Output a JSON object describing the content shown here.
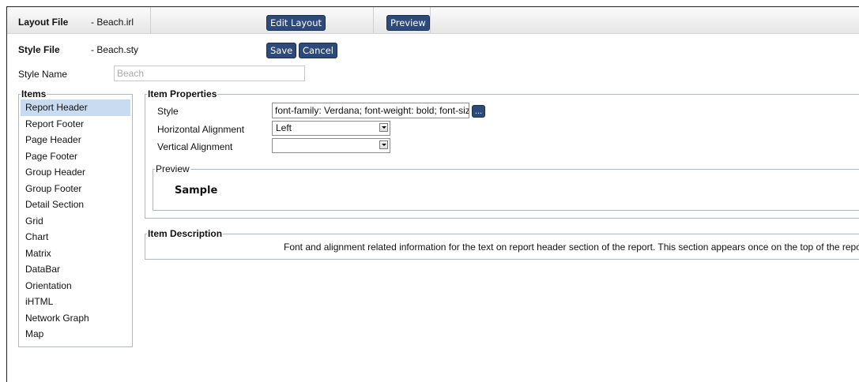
{
  "header": {
    "layout_file_label": "Layout File",
    "layout_file_value": "-  Beach.irl",
    "edit_layout_label": "Edit Layout",
    "preview_label": "Preview"
  },
  "style_file": {
    "label": "Style File",
    "value": "-  Beach.sty",
    "save_label": "Save",
    "cancel_label": "Cancel"
  },
  "style_name": {
    "label": "Style Name",
    "placeholder": "Beach"
  },
  "items": {
    "legend": "Items",
    "list": [
      "Report Header",
      "Report Footer",
      "Page Header",
      "Page Footer",
      "Group Header",
      "Group Footer",
      "Detail Section",
      "Grid",
      "Chart",
      "Matrix",
      "DataBar",
      "Orientation",
      "iHTML",
      "Network Graph",
      "Map"
    ],
    "selected": "Report Header"
  },
  "item_properties": {
    "legend": "Item Properties",
    "style_label": "Style",
    "style_value": "font-family: Verdana; font-weight: bold; font-siz",
    "style_button_label": "...",
    "horizontal_alignment_label": "Horizontal Alignment",
    "horizontal_alignment_value": "Left",
    "vertical_alignment_label": "Vertical Alignment",
    "vertical_alignment_value": "",
    "preview_legend": "Preview",
    "preview_sample": "Sample"
  },
  "item_description": {
    "legend": "Item Description",
    "text": "Font and alignment related information for the text on report header section of the report. This section appears once on the top of the repor"
  },
  "colors": {
    "button_bg": "#2d4a7a",
    "selected_item_bg": "#c9dbf0",
    "fieldset_border": "#a9bacb"
  }
}
